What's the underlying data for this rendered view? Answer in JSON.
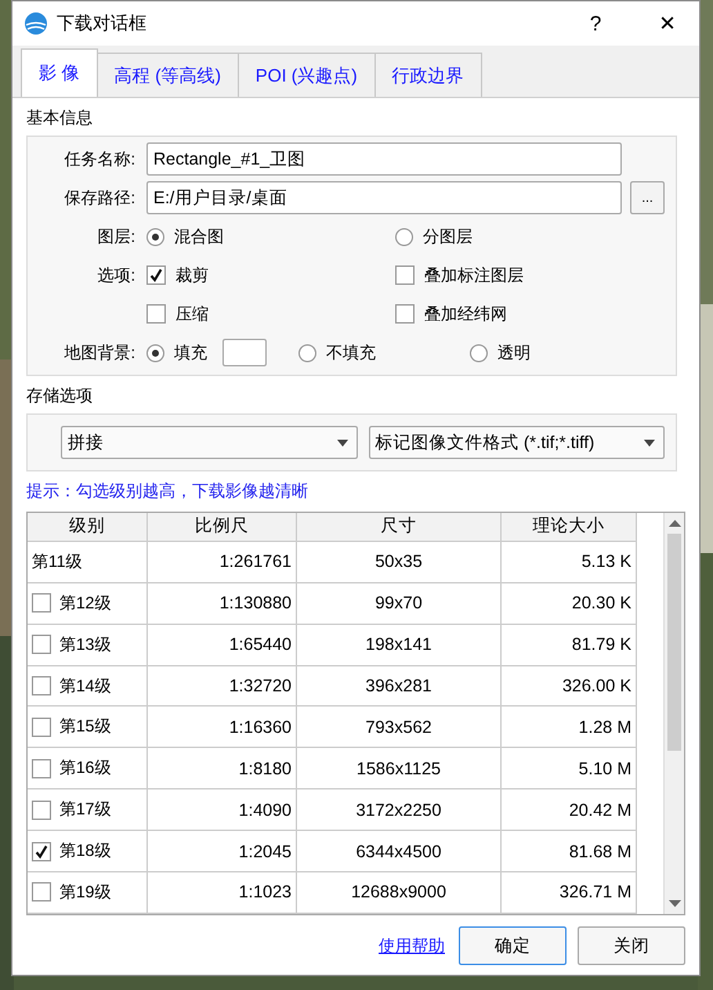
{
  "window": {
    "title": "下载对话框",
    "help": "?",
    "close": "✕"
  },
  "tabs": [
    {
      "label": "影 像",
      "selected": true
    },
    {
      "label": "高程 (等高线)",
      "selected": false
    },
    {
      "label": "POI (兴趣点)",
      "selected": false
    },
    {
      "label": "行政边界",
      "selected": false
    }
  ],
  "basic_info": {
    "title": "基本信息",
    "task_name": {
      "label": "任务名称:",
      "value": "Rectangle_#1_卫图"
    },
    "save_path": {
      "label": "保存路径:",
      "value": "E:/用户目录/桌面",
      "browse": "..."
    },
    "layer": {
      "label": "图层:",
      "options": [
        {
          "label": "混合图",
          "selected": true
        },
        {
          "label": "分图层",
          "selected": false
        }
      ]
    },
    "options": {
      "label": "选项:",
      "items": [
        {
          "label": "裁剪",
          "checked": true
        },
        {
          "label": "叠加标注图层",
          "checked": false
        },
        {
          "label": "压缩",
          "checked": false
        },
        {
          "label": "叠加经纬网",
          "checked": false
        }
      ]
    },
    "background": {
      "label": "地图背景:",
      "options": [
        {
          "label": "填充",
          "selected": true
        },
        {
          "label": "不填充",
          "selected": false
        },
        {
          "label": "透明",
          "selected": false
        }
      ]
    }
  },
  "storage": {
    "title": "存储选项",
    "mode": "拼接",
    "format": "标记图像文件格式 (*.tif;*.tiff)"
  },
  "hint": "提示：勾选级别越高，下载影像越清晰",
  "table": {
    "columns": [
      "级别",
      "比例尺",
      "尺寸",
      "理论大小"
    ],
    "rows": [
      {
        "kind": "plain",
        "level": "第11级",
        "scale": "1:261761",
        "size": "50x35",
        "data_size": "5.13 K"
      },
      {
        "kind": "checkbox",
        "checked": false,
        "level": "第12级",
        "scale": "1:130880",
        "size": "99x70",
        "data_size": "20.30 K"
      },
      {
        "kind": "checkbox",
        "checked": false,
        "level": "第13级",
        "scale": "1:65440",
        "size": "198x141",
        "data_size": "81.79 K"
      },
      {
        "kind": "checkbox",
        "checked": false,
        "level": "第14级",
        "scale": "1:32720",
        "size": "396x281",
        "data_size": "326.00 K"
      },
      {
        "kind": "checkbox",
        "checked": false,
        "level": "第15级",
        "scale": "1:16360",
        "size": "793x562",
        "data_size": "1.28 M"
      },
      {
        "kind": "checkbox",
        "checked": false,
        "level": "第16级",
        "scale": "1:8180",
        "size": "1586x1125",
        "data_size": "5.10 M"
      },
      {
        "kind": "checkbox",
        "checked": false,
        "level": "第17级",
        "scale": "1:4090",
        "size": "3172x2250",
        "data_size": "20.42 M"
      },
      {
        "kind": "checkbox",
        "checked": true,
        "level": "第18级",
        "scale": "1:2045",
        "size": "6344x4500",
        "data_size": "81.68 M"
      },
      {
        "kind": "checkbox",
        "checked": false,
        "level": "第19级",
        "scale": "1:1023",
        "size": "12688x9000",
        "data_size": "326.71 M"
      }
    ]
  },
  "footer": {
    "help_link": "使用帮助",
    "ok": "确定",
    "close": "关闭"
  }
}
